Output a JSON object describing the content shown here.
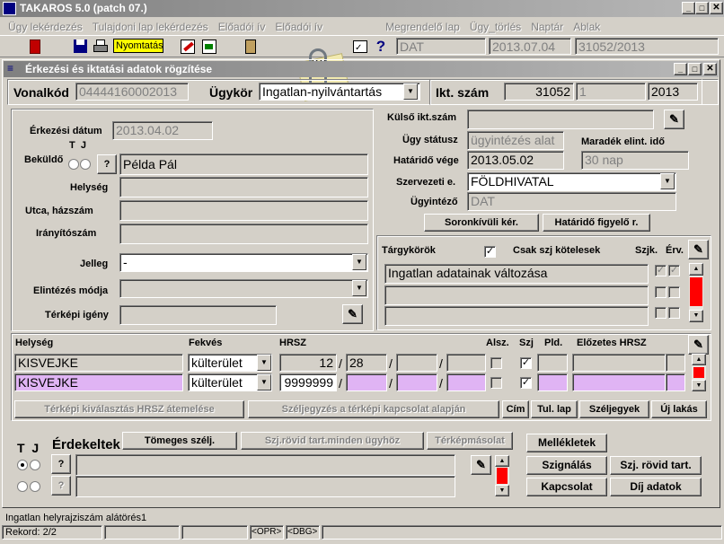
{
  "app_title": "TAKAROS 5.0 (patch 07.)",
  "menu": [
    "Ügy lekérdezés",
    "Tulajdoni lap lekérdezés",
    "Előadói ív",
    "Előadói ív",
    "Megrendelő lap",
    "Ügy_törlés",
    "Naptár",
    "Ablak"
  ],
  "toolbar": {
    "print_tooltip": "Nyomtatás",
    "user": "DAT",
    "date": "2013.07.04",
    "case_ref": "31052/2013"
  },
  "form_title": "Érkezési és iktatási adatok rögzítése",
  "top": {
    "vonalkod_label": "Vonalkód",
    "vonalkod": "04444160002013",
    "ugykor_label": "Ügykör",
    "ugykor": "Ingatlan-nyilvántartás",
    "iktszam_label": "Ikt. szám",
    "ikt_no": "31052",
    "ikt_sub": "1",
    "ikt_year": "2013"
  },
  "left": {
    "erkezesi_datum_label": "Érkezési dátum",
    "erkezesi_datum": "2013.04.02",
    "tj": "T  J",
    "bekuldo_label": "Beküldő",
    "bekuldo_q": "?",
    "bekuldo": "Példa Pál",
    "helyseg_label": "Helység",
    "utca_label": "Utca, házszám",
    "irsz_label": "Irányítószám",
    "jelleg_label": "Jelleg",
    "jelleg": "-",
    "elintezes_label": "Elintézés módja",
    "terkepi_label": "Térképi igény"
  },
  "right": {
    "kulso_label": "Külső ikt.szám",
    "ugy_status_label": "Ügy státusz",
    "ugy_status": "ügyintézés alat",
    "maradek_label": "Maradék elint. idő",
    "hatarido_label": "Határidő vége",
    "hatarido": "2013.05.02",
    "maradek": "30 nap",
    "szervezeti_label": "Szervezeti e.",
    "szervezeti": "FÖLDHIVATAL",
    "ugyintezo_label": "Ügyintéző",
    "ugyintezo": "DAT",
    "soronkivuli_btn": "Soronkívüli kér.",
    "hatarido_figyelo_btn": "Határidő figyelő r."
  },
  "targy": {
    "label": "Tárgykörök",
    "csak_label": "Csak szj kötelesek",
    "szjk_label": "Szjk.",
    "erv_label": "Érv.",
    "items": [
      "Ingatlan adatainak változása",
      "",
      ""
    ]
  },
  "hrsz": {
    "headers": {
      "helyseg": "Helység",
      "fekves": "Fekvés",
      "hrsz": "HRSZ",
      "alsz": "Alsz.",
      "szj": "Szj",
      "pld": "Pld.",
      "elozetes": "Előzetes HRSZ"
    },
    "rows": [
      {
        "helyseg": "KISVEJKE",
        "fekves": "külterület",
        "hrsz": "12",
        "p2": "28",
        "p3": "",
        "p4": ""
      },
      {
        "helyseg": "KISVEJKE",
        "fekves": "külterület",
        "hrsz": "9999999",
        "p2": "",
        "p3": "",
        "p4": ""
      }
    ],
    "btn_terkepi": "Térképi kiválasztás HRSZ átemelése",
    "btn_szeljegyzes": "Széljegyzés a térképi kapcsolat alapján",
    "btn_cim": "Cím",
    "btn_tullap": "Tul. lap",
    "btn_szeljegyek": "Széljegyek",
    "btn_ujlakas": "Új lakás"
  },
  "erdekeltek": {
    "tj": "T  J",
    "label": "Érdekeltek",
    "btn_tomeges": "Tömeges szélj.",
    "btn_szjrovid_minden": "Szj.rövid tart.minden ügyhöz",
    "btn_terkepmasolat": "Térképmásolat",
    "q": "?"
  },
  "actions": {
    "mellekletek": "Mellékletek",
    "szignalas": "Szignálás",
    "szj_rovid": "Szj. rövid tart.",
    "kapcsolat": "Kapcsolat",
    "dij": "Díj adatok"
  },
  "status": {
    "message": "Ingatlan helyrajziszám alátörés1",
    "rekord": "Rekord: 2/2",
    "opr": "<OPR>",
    "dbg": "<DBG>"
  },
  "colors": {
    "title_active": "#0a246a",
    "title_inactive": "#808080",
    "pink_field": "#e0b4f4",
    "red_scroll": "#ff0000",
    "tooltip": "#ffff00"
  }
}
